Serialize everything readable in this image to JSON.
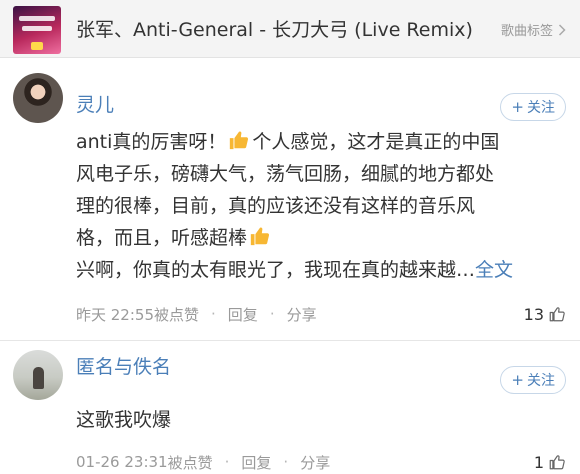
{
  "song": {
    "title": "张军、Anti-General - 长刀大弓 (Live Remix)",
    "tags_label": "歌曲标签"
  },
  "comments": [
    {
      "username": "灵儿",
      "follow_label": "关注",
      "lines": [
        {
          "pre": "anti真的厉害呀！",
          "post": "个人感觉，这才是真正的中国"
        },
        "风电子乐，磅礴大气，荡气回肠，细腻的地方都处",
        "理的很棒，目前，真的应该还没有这样的音乐风",
        {
          "pre": "格，而且，听感超棒",
          "post": ""
        },
        "兴啊，你真的太有眼光了，我现在真的越来越…"
      ],
      "more_label": "全文",
      "time": "昨天 22:55",
      "liked_by": "被点赞",
      "reply_label": "回复",
      "share_label": "分享",
      "likes": "13"
    },
    {
      "username": "匿名与佚名",
      "follow_label": "关注",
      "text": "这歌我吹爆",
      "time": "01-26 23:31",
      "liked_by": "被点赞",
      "reply_label": "回复",
      "share_label": "分享",
      "likes": "1"
    }
  ],
  "colors": {
    "link_blue": "#4b7fb8",
    "meta_gray": "#9a9a9a",
    "thumb_yellow": "#f7b733"
  },
  "icons": {
    "tags_arrow": "chevron-right-icon",
    "follow": "plus-icon",
    "thumbs_up_emoji": "thumbs-up-icon",
    "like": "like-icon"
  }
}
